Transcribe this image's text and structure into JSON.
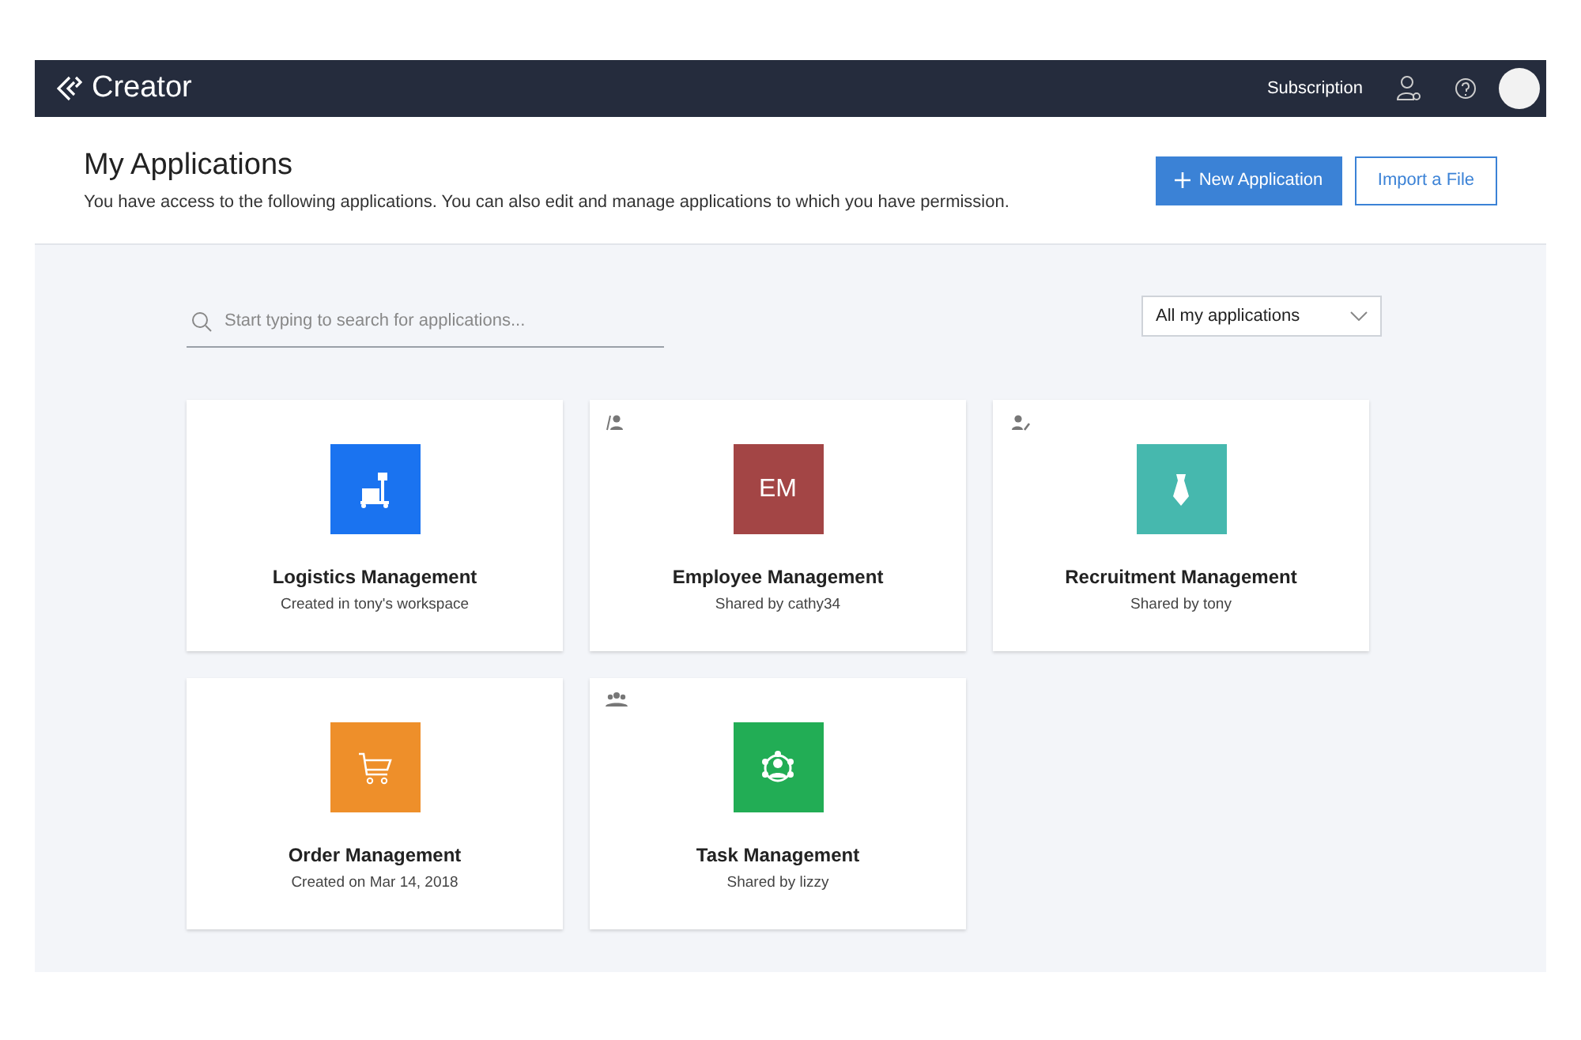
{
  "topbar": {
    "brand": "Creator",
    "subscription": "Subscription"
  },
  "header": {
    "title": "My Applications",
    "subtitle": "You have access to the following applications. You can also edit and manage applications to which you have permission.",
    "primary_button": "New Application",
    "secondary_button": "Import a File"
  },
  "search": {
    "placeholder": "Start typing to search for applications..."
  },
  "filter": {
    "value": "All my applications"
  },
  "apps": [
    {
      "name": "Logistics Management",
      "meta": "Created in tony's workspace",
      "tile": {
        "kind": "trolley",
        "color": "#1a73f0"
      }
    },
    {
      "name": "Employee Management",
      "meta": "Shared by cathy34",
      "tile": {
        "kind": "initials",
        "initials": "EM",
        "color": "#a34545"
      },
      "badge": {
        "kind": "user"
      }
    },
    {
      "name": "Recruitment Management",
      "meta": "Shared by tony",
      "tile": {
        "kind": "tie",
        "color": "#46b8ae"
      },
      "badge": {
        "kind": "useredit"
      }
    },
    {
      "name": "Order Management",
      "meta": "Created on Mar 14, 2018",
      "tile": {
        "kind": "cart",
        "color": "#ee8f2a"
      }
    },
    {
      "name": "Task Management",
      "meta": "Shared by lizzy",
      "tile": {
        "kind": "team",
        "color": "#22ad55"
      },
      "badge": {
        "kind": "group"
      }
    }
  ]
}
